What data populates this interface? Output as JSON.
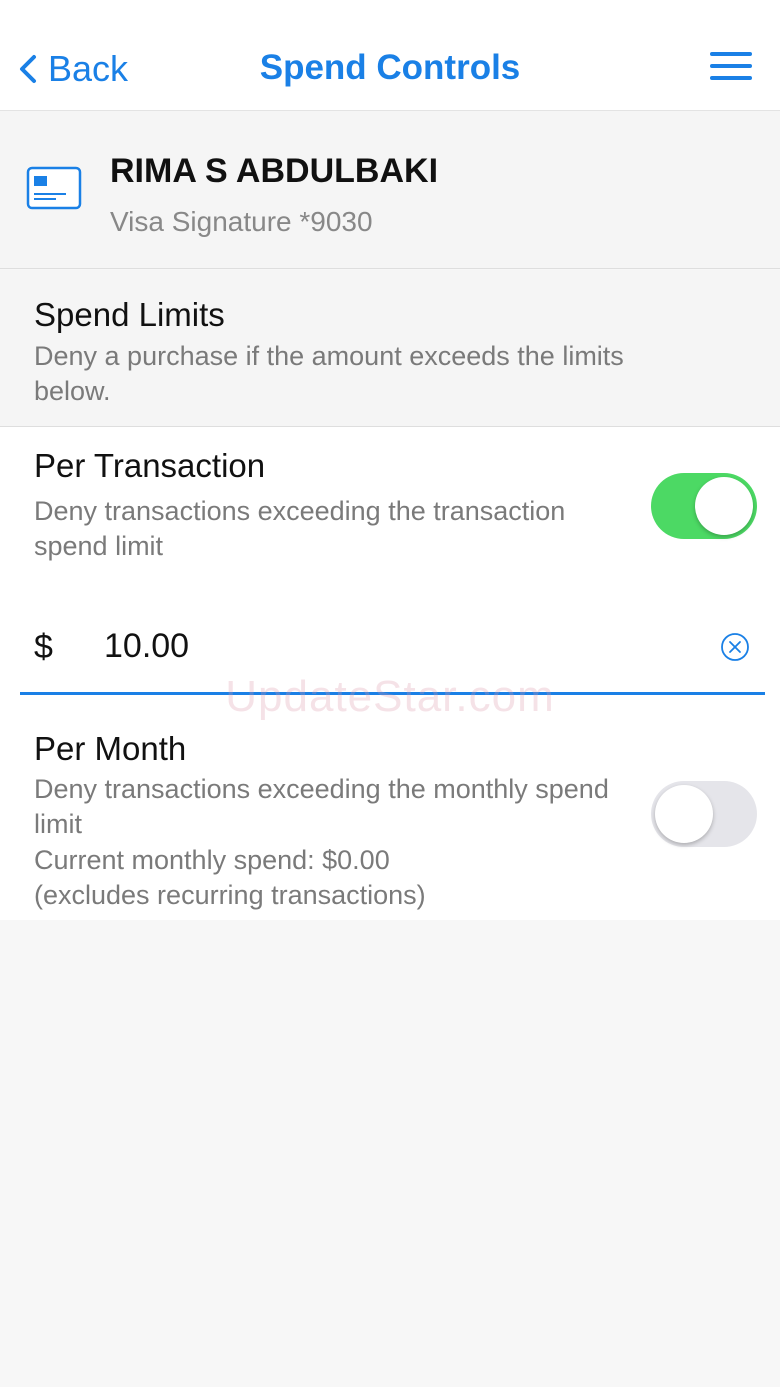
{
  "nav": {
    "back_label": "Back",
    "title": "Spend Controls",
    "menu_icon": "hamburger-menu-icon"
  },
  "card": {
    "icon": "credit-card-icon",
    "holder_name": "RIMA S ABDULBAKI",
    "card_type": "Visa Signature *9030"
  },
  "spend_limits": {
    "title": "Spend Limits",
    "description": "Deny a purchase if the amount exceeds the limits below."
  },
  "per_transaction": {
    "title": "Per Transaction",
    "description": "Deny transactions exceeding the transaction spend limit",
    "enabled": true,
    "currency_symbol": "$",
    "amount": "10.00"
  },
  "per_month": {
    "title": "Per Month",
    "description": "Deny transactions exceeding the monthly spend limit",
    "current_spend": "Current monthly spend: $0.00",
    "note": "(excludes recurring transactions)",
    "enabled": false
  },
  "watermark": "UpdateStar.com",
  "colors": {
    "accent": "#1a80e6",
    "toggle_on": "#4cd964",
    "toggle_off": "#e5e5ea"
  }
}
